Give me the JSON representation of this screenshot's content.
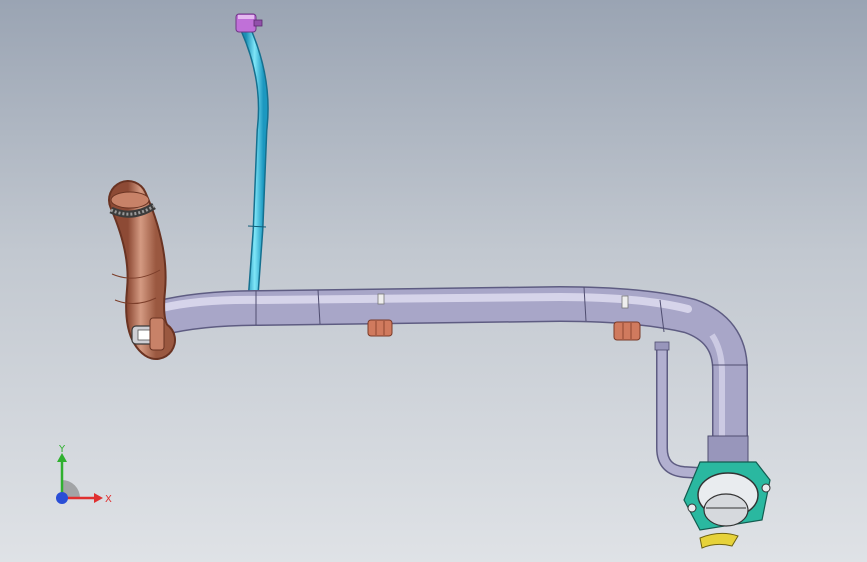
{
  "viewport": {
    "background_top": "#9aa4b3",
    "background_bottom": "#dfe2e6"
  },
  "model": {
    "main_pipe_color": "#a8a6c8",
    "filler_hose_color": "#b86e55",
    "vent_line_color": "#33c6e6",
    "vent_cap_color": "#c070d8",
    "filler_neck_ring_color": "#2ab8a0",
    "clamp_color": "#d07a5e"
  },
  "triad": {
    "x_label": "X",
    "y_label": "Y",
    "x_color": "#e03030",
    "y_color": "#30b030",
    "z_color": "#2a4ed6"
  }
}
